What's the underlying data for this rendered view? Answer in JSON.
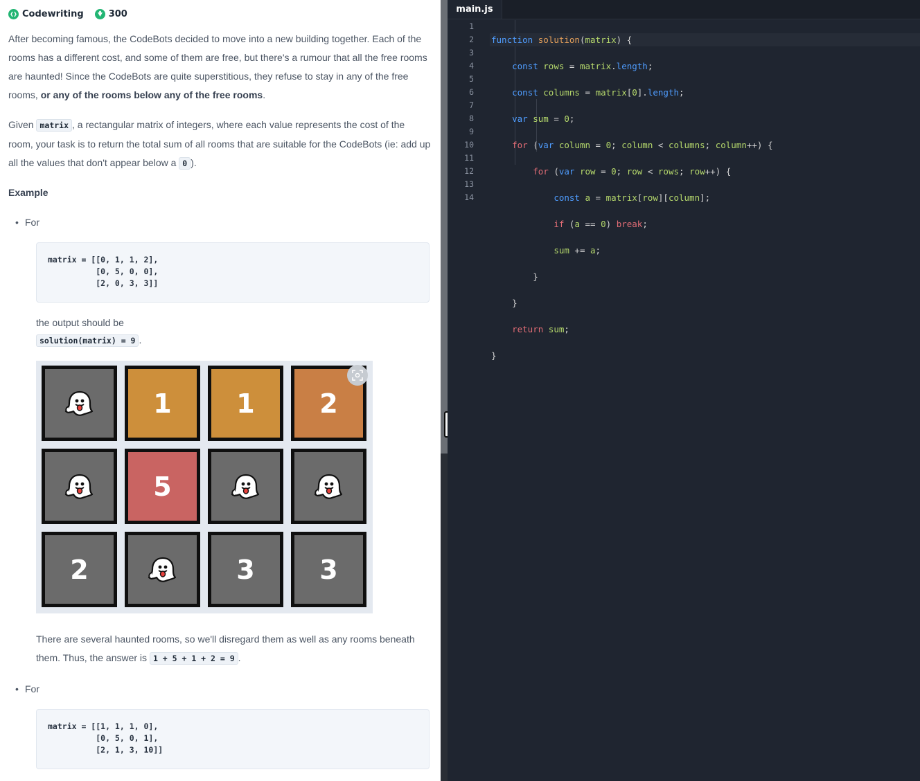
{
  "header": {
    "brand": "Codewriting",
    "points": "300"
  },
  "description": {
    "p1_main": "After becoming famous, the CodeBots decided to move into a new building together. Each of the rooms has a different cost, and some of them are free, but there's a rumour that all the free rooms are haunted! Since the CodeBots are quite superstitious, they refuse to stay in any of the free rooms,",
    "p1_bold": "or any of the rooms below any of the free rooms",
    "p1_end": ".",
    "p2_a": "Given",
    "p2_code": "matrix",
    "p2_b": ", a rectangular matrix of integers, where each value represents the cost of the room, your task is to return the total sum of all rooms that are suitable for the CodeBots (ie: add up all the values that don't appear below a",
    "p2_code2": "0",
    "p2_c": ")."
  },
  "example": {
    "heading": "Example",
    "bullet1": "For",
    "code1": "matrix = [[0, 1, 1, 2],\n          [0, 5, 0, 0],\n          [2, 0, 3, 3]]",
    "output_label": "the output should be",
    "output_code": "solution(matrix) = 9",
    "output_end": ".",
    "grid": [
      [
        {
          "v": "0",
          "color": "#6b6b6b",
          "ghost": true
        },
        {
          "v": "1",
          "color": "#cd8f3b"
        },
        {
          "v": "1",
          "color": "#cd8f3b"
        },
        {
          "v": "2",
          "color": "#c97f45"
        }
      ],
      [
        {
          "v": "0",
          "color": "#6b6b6b",
          "ghost": true
        },
        {
          "v": "5",
          "color": "#c96462"
        },
        {
          "v": "0",
          "color": "#6b6b6b",
          "ghost": true
        },
        {
          "v": "0",
          "color": "#6b6b6b",
          "ghost": true
        }
      ],
      [
        {
          "v": "2",
          "color": "#6b6b6b"
        },
        {
          "v": "0",
          "color": "#6b6b6b",
          "ghost": true
        },
        {
          "v": "3",
          "color": "#6b6b6b"
        },
        {
          "v": "3",
          "color": "#6b6b6b"
        }
      ]
    ],
    "explain_a": "There are several haunted rooms, so we'll disregard them as well as any rooms beneath them. Thus, the answer is",
    "explain_code": "1 + 5 + 1 + 2 = 9",
    "explain_end": ".",
    "bullet2": "For",
    "code2": "matrix = [[1, 1, 1, 0],\n          [0, 5, 0, 1],\n          [2, 1, 3, 10]]"
  },
  "editor": {
    "tab": "main.js",
    "line_numbers": [
      "1",
      "2",
      "3",
      "4",
      "5",
      "6",
      "7",
      "8",
      "9",
      "10",
      "11",
      "12",
      "13",
      "14"
    ]
  },
  "colors": {
    "accent_green": "#22b573",
    "editor_bg": "#1f2530",
    "keyword": "#4f9dff",
    "function": "#e5a05a",
    "variable": "#b6d96c"
  }
}
